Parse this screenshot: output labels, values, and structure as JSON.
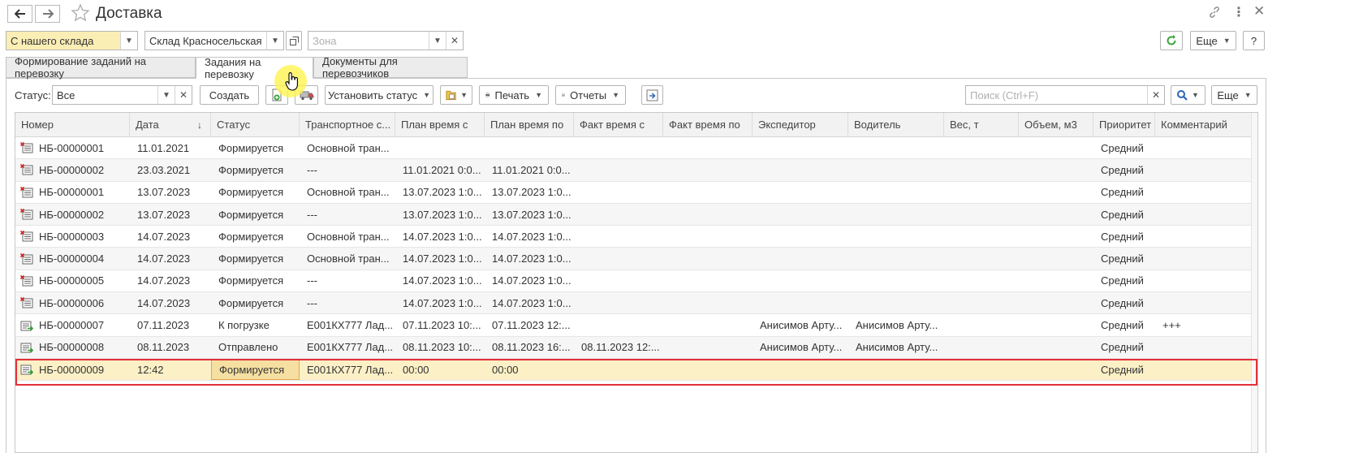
{
  "window": {
    "title": "Доставка",
    "back_icon": "arrow-left-icon",
    "forward_icon": "arrow-right-icon",
    "favorite_icon": "star-icon",
    "link_icon": "link-icon",
    "menu_icon": "more-vertical-icon",
    "close_icon": "close-icon"
  },
  "filters": {
    "source_value": "С нашего склада",
    "warehouse_value": "Склад Красносельская",
    "zone_placeholder": "Зона",
    "refresh_icon": "refresresh-icon",
    "more_label": "Еще",
    "help_label": "?"
  },
  "tabs": [
    {
      "label": "Формирование заданий на перевозку"
    },
    {
      "label": "Задания на перевозку"
    },
    {
      "label": "Документы для перевозчиков"
    }
  ],
  "toolbar": {
    "status_label": "Статус:",
    "status_value": "Все",
    "create_label": "Создать",
    "set_status_label": "Установить статус",
    "print_label": "Печать",
    "reports_label": "Отчеты",
    "search_placeholder": "Поиск (Ctrl+F)",
    "more_label": "Еще"
  },
  "table": {
    "columns": [
      "Номер",
      "Дата",
      "Статус",
      "Транспортное с...",
      "План время с",
      "План время по",
      "Факт время с",
      "Факт время по",
      "Экспедитор",
      "Водитель",
      "Вес, т",
      "Объем, м3",
      "Приоритет",
      "Комментарий"
    ],
    "rows": [
      {
        "icon": "doc-draft-icon",
        "cells": [
          "НБ-00000001",
          "11.01.2021",
          "Формируется",
          "Основной тран...",
          "",
          "",
          "",
          "",
          "",
          "",
          "",
          "",
          "Средний",
          ""
        ]
      },
      {
        "icon": "doc-draft-icon",
        "cells": [
          "НБ-00000002",
          "23.03.2021",
          "Формируется",
          "---",
          "11.01.2021 0:0...",
          "11.01.2021 0:0...",
          "",
          "",
          "",
          "",
          "",
          "",
          "Средний",
          ""
        ]
      },
      {
        "icon": "doc-draft-icon",
        "cells": [
          "НБ-00000001",
          "13.07.2023",
          "Формируется",
          "Основной тран...",
          "13.07.2023 1:0...",
          "13.07.2023 1:0...",
          "",
          "",
          "",
          "",
          "",
          "",
          "Средний",
          ""
        ]
      },
      {
        "icon": "doc-draft-icon",
        "cells": [
          "НБ-00000002",
          "13.07.2023",
          "Формируется",
          "---",
          "13.07.2023 1:0...",
          "13.07.2023 1:0...",
          "",
          "",
          "",
          "",
          "",
          "",
          "Средний",
          ""
        ]
      },
      {
        "icon": "doc-draft-icon",
        "cells": [
          "НБ-00000003",
          "14.07.2023",
          "Формируется",
          "Основной тран...",
          "14.07.2023 1:0...",
          "14.07.2023 1:0...",
          "",
          "",
          "",
          "",
          "",
          "",
          "Средний",
          ""
        ]
      },
      {
        "icon": "doc-draft-icon",
        "cells": [
          "НБ-00000004",
          "14.07.2023",
          "Формируется",
          "Основной тран...",
          "14.07.2023 1:0...",
          "14.07.2023 1:0...",
          "",
          "",
          "",
          "",
          "",
          "",
          "Средний",
          ""
        ]
      },
      {
        "icon": "doc-draft-icon",
        "cells": [
          "НБ-00000005",
          "14.07.2023",
          "Формируется",
          "---",
          "14.07.2023 1:0...",
          "14.07.2023 1:0...",
          "",
          "",
          "",
          "",
          "",
          "",
          "Средний",
          ""
        ]
      },
      {
        "icon": "doc-draft-icon",
        "cells": [
          "НБ-00000006",
          "14.07.2023",
          "Формируется",
          "---",
          "14.07.2023 1:0...",
          "14.07.2023 1:0...",
          "",
          "",
          "",
          "",
          "",
          "",
          "Средний",
          ""
        ]
      },
      {
        "icon": "doc-posted-icon",
        "cells": [
          "НБ-00000007",
          "07.11.2023",
          "К погрузке",
          "Е001КХ777 Лад...",
          "07.11.2023 10:...",
          "07.11.2023 12:...",
          "",
          "",
          "Анисимов Арту...",
          "Анисимов Арту...",
          "",
          "",
          "Средний",
          "+++"
        ]
      },
      {
        "icon": "doc-posted-icon",
        "cells": [
          "НБ-00000008",
          "08.11.2023",
          "Отправлено",
          "Е001КХ777 Лад...",
          "08.11.2023 10:...",
          "08.11.2023 16:...",
          "08.11.2023 12:...",
          "",
          "Анисимов Арту...",
          "Анисимов Арту...",
          "",
          "",
          "Средний",
          ""
        ]
      },
      {
        "icon": "doc-posted-icon",
        "cells": [
          "НБ-00000009",
          "12:42",
          "Формируется",
          "Е001КХ777 Лад...",
          "00:00",
          "00:00",
          "",
          "",
          "",
          "",
          "",
          "",
          "Средний",
          ""
        ]
      }
    ]
  },
  "colors": {
    "accent_green": "#3aa53a",
    "selection_frame": "#e3313a",
    "selected_row": "#fbf0c6",
    "field_highlight": "#fbeeb5"
  }
}
